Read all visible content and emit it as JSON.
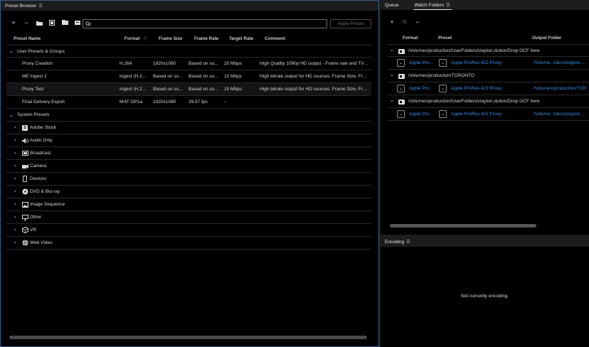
{
  "preset_browser": {
    "title": "Preset Browser",
    "apply_label": "Apply Preset",
    "columns": {
      "name": "Preset Name",
      "format": "Format",
      "frame_size": "Frame Size",
      "frame_rate": "Frame Rate",
      "target_rate": "Target Rate",
      "comment": "Comment"
    },
    "user_group": "User Presets & Groups",
    "user_presets": [
      {
        "name": "Proxy Creation",
        "format": "H.264",
        "frame_size": "1920x1080",
        "frame_rate": "Based on so...",
        "target_rate": "20 Mbps",
        "comment": "High Quality 1080p HD output - Frame rate and TV sta..."
      },
      {
        "name": "ME Ingest 2",
        "format": "Ingest (H.2...",
        "frame_size": "Based on so...",
        "frame_rate": "Based on so...",
        "target_rate": "10 Mbps",
        "comment": "High bitrate output for HD sources. Frame Size, Frame R..."
      },
      {
        "name": "Proxy Test",
        "format": "Ingest (H.2...",
        "frame_size": "Based on so...",
        "frame_rate": "Based on so...",
        "target_rate": "10 Mbps",
        "comment": "High bitrate output for HD sources. Frame Size, Frame R..."
      },
      {
        "name": "Final Delivery Export",
        "format": "MXF OP1a",
        "frame_size": "1920x1080",
        "frame_rate": "29.97 fps",
        "target_rate": "-",
        "comment": ""
      }
    ],
    "system_group": "System Presets",
    "system_presets": [
      {
        "label": "Adobe Stock",
        "icon": "stock-icon"
      },
      {
        "label": "Audio Only",
        "icon": "speaker-icon"
      },
      {
        "label": "Broadcast",
        "icon": "broadcast-icon"
      },
      {
        "label": "Camera",
        "icon": "camera-icon"
      },
      {
        "label": "Devices",
        "icon": "device-icon"
      },
      {
        "label": "DVD & Blu-ray",
        "icon": "disc-icon"
      },
      {
        "label": "Image Sequence",
        "icon": "image-icon"
      },
      {
        "label": "Other",
        "icon": "monitor-icon"
      },
      {
        "label": "VR",
        "icon": "vr-icon"
      },
      {
        "label": "Web Video",
        "icon": "globe-icon"
      }
    ]
  },
  "right_tabs": {
    "queue": "Queue",
    "watch": "Watch Folders"
  },
  "watch_folders": {
    "columns": {
      "format": "Format",
      "preset": "Preset",
      "output": "Output Folder"
    },
    "folders": [
      {
        "path": "/Volumes/production/UserFolders/clayton.dutton/Drop OCF here",
        "format": "Apple Pro...",
        "preset": "Apple ProRes 422 Proxy",
        "output": "/Volume...lders/clayton.dutton"
      },
      {
        "path": "/Volumes/production/TORONTO",
        "format": "Apple Pro...",
        "preset": "Apple ProRes 422 Proxy",
        "output": "/Volumes/production/TOR"
      },
      {
        "path": "/Volumes/production/UserFolders/clayton.dutton/Drop OCF here",
        "format": "Apple Pro...",
        "preset": "Apple ProRes 422 Proxy",
        "output": "/Volume...lders/clayton.dutton"
      }
    ]
  },
  "encoding": {
    "title": "Encoding",
    "status": "Not currently encoding."
  },
  "colors": {
    "accent": "#3d8de6",
    "panel_border": "#3a5a8a"
  }
}
